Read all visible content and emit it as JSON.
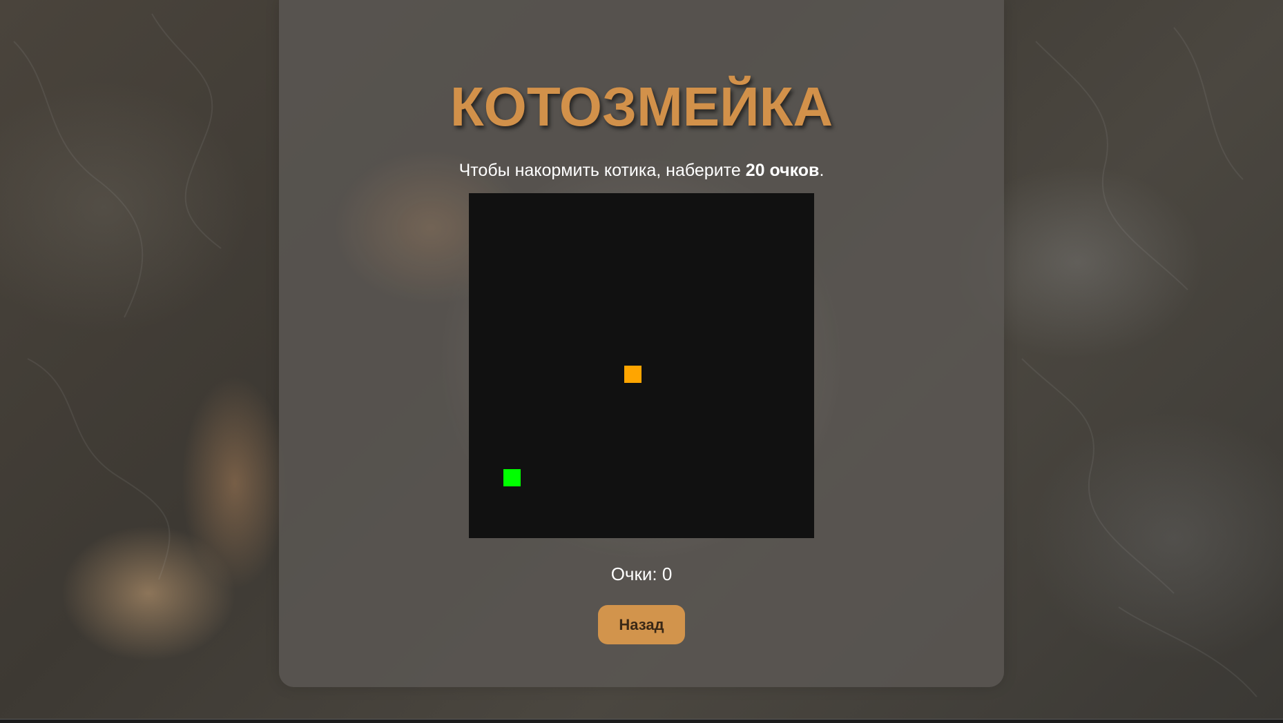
{
  "game": {
    "title": "КОТОЗМЕЙКА",
    "instruction_prefix": "Чтобы накормить котика, наберите ",
    "instruction_goal": "20 очков",
    "instruction_suffix": ".",
    "score_label": "Очки: ",
    "score_value": "0",
    "back_button_label": "Назад"
  },
  "board": {
    "grid_size": 20,
    "background_color": "#111111",
    "snake": [
      {
        "col": 2,
        "row": 16
      }
    ],
    "snake_color": "#00ff00",
    "food": {
      "col": 9,
      "row": 10
    },
    "food_color": "#ffa500"
  },
  "colors": {
    "accent": "#d2914a",
    "button": "#d2944c"
  }
}
